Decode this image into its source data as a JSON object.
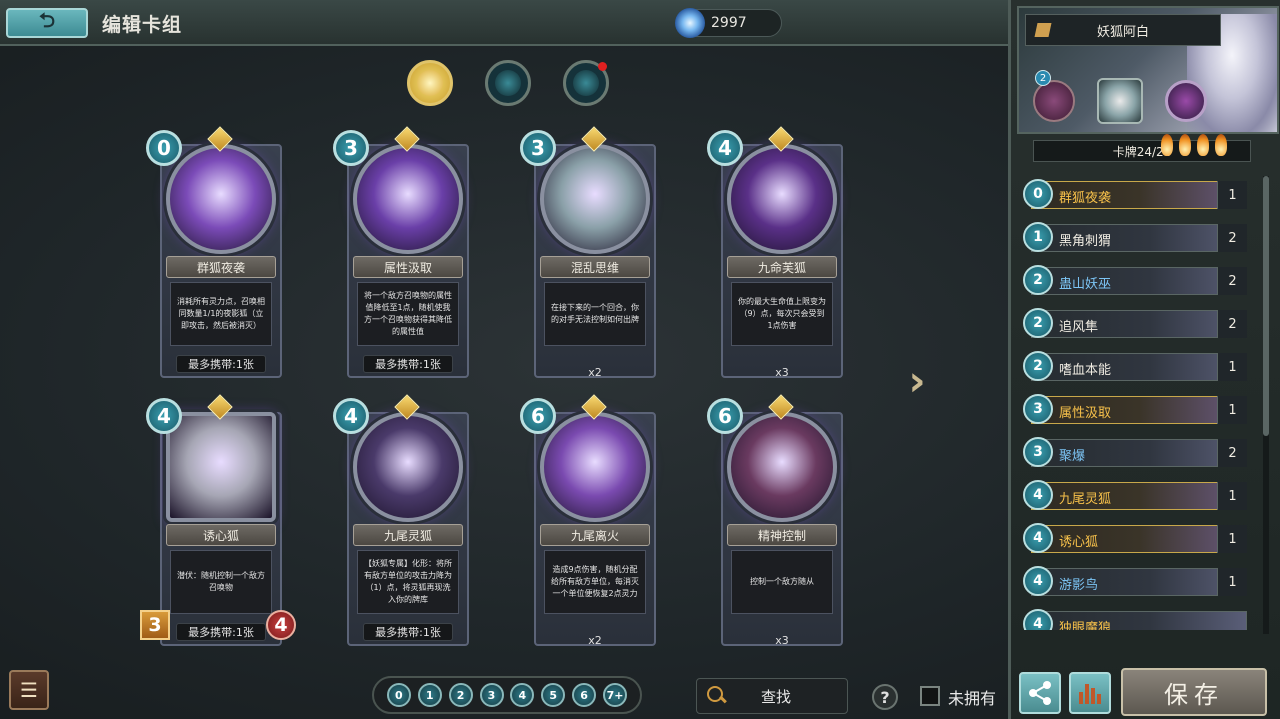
{
  "header": {
    "back_label": "⮌",
    "title": "编辑卡组",
    "currency_value": "2997"
  },
  "filters": [
    {
      "name": "filter-gold-fox",
      "active": true
    },
    {
      "name": "filter-teal-swirl",
      "active": false
    },
    {
      "name": "filter-teal-swirl-new",
      "active": false,
      "has_notification": true
    }
  ],
  "cards": [
    {
      "cost": "0",
      "name": "群狐夜袭",
      "desc": "消耗所有灵力点，召唤相同数量1/1的夜影狐（立即攻击，然后被消灭）",
      "limit": "最多携带:1张",
      "count": "",
      "art": "#7b4bb8"
    },
    {
      "cost": "3",
      "name": "属性汲取",
      "desc": "将一个敌方召唤物的属性值降低至1点，随机使我方一个召唤物获得其降低的属性值",
      "limit": "最多携带:1张",
      "count": "",
      "art": "#6a3fa8"
    },
    {
      "cost": "3",
      "name": "混乱思维",
      "desc": "在接下来的一个回合，你的对手无法控制如何出牌",
      "limit": "",
      "count": "x2",
      "art": "#8aa0a8"
    },
    {
      "cost": "4",
      "name": "九命芙狐",
      "desc": "你的最大生命值上限变为（9）点，每次只会受到1点伤害",
      "limit": "",
      "count": "x3",
      "art": "#5a3088"
    },
    {
      "cost": "4",
      "name": "诱心狐",
      "desc": "潜伏：随机控制一个敌方召唤物",
      "limit": "最多携带:1张",
      "count": "",
      "art": "#a6a6b4",
      "square": true,
      "atk": "3",
      "hp": "4"
    },
    {
      "cost": "4",
      "name": "九尾灵狐",
      "desc": "【妖狐专属】化形：将所有敌方单位的攻击力降为（1）点，将灵狐再现洗入你的牌库",
      "limit": "最多携带:1张",
      "count": "",
      "art": "#4a3a6a"
    },
    {
      "cost": "6",
      "name": "九尾离火",
      "desc": "造成9点伤害，随机分配给所有敌方单位，每消灭一个单位便恢复2点灵力",
      "limit": "",
      "count": "x2",
      "art": "#7a4ab0"
    },
    {
      "cost": "6",
      "name": "精神控制",
      "desc": "控制一个敌方随从",
      "limit": "",
      "count": "x3",
      "art": "#6a3a60"
    }
  ],
  "bottom": {
    "menu_icon": "☰",
    "cost_filters": [
      "0",
      "1",
      "2",
      "3",
      "4",
      "5",
      "6",
      "7+"
    ],
    "search_label": "查找",
    "help_label": "?",
    "unowned_label": "未拥有"
  },
  "deck": {
    "name": "妖狐阿白",
    "badge": "2",
    "count_label": "卡牌24/24",
    "cards": [
      {
        "cost": "0",
        "name": "群狐夜袭",
        "qty": "1",
        "style": "gold",
        "rare": true
      },
      {
        "cost": "1",
        "name": "黑角刺猬",
        "qty": "2",
        "style": "",
        "rare": false
      },
      {
        "cost": "2",
        "name": "蛊山妖巫",
        "qty": "2",
        "style": "blue",
        "rare": false
      },
      {
        "cost": "2",
        "name": "追风隼",
        "qty": "2",
        "style": "",
        "rare": false
      },
      {
        "cost": "2",
        "name": "嗜血本能",
        "qty": "1",
        "style": "",
        "rare": false
      },
      {
        "cost": "3",
        "name": "属性汲取",
        "qty": "1",
        "style": "gold",
        "rare": true
      },
      {
        "cost": "3",
        "name": "聚爆",
        "qty": "2",
        "style": "blue",
        "rare": false
      },
      {
        "cost": "4",
        "name": "九尾灵狐",
        "qty": "1",
        "style": "gold",
        "rare": true
      },
      {
        "cost": "4",
        "name": "诱心狐",
        "qty": "1",
        "style": "gold",
        "rare": true
      },
      {
        "cost": "4",
        "name": "游影鸟",
        "qty": "1",
        "style": "blue",
        "rare": false
      },
      {
        "cost": "4",
        "name": "独眼魔狼",
        "qty": "",
        "style": "gold",
        "rare": false
      }
    ],
    "save_label": "保存"
  }
}
